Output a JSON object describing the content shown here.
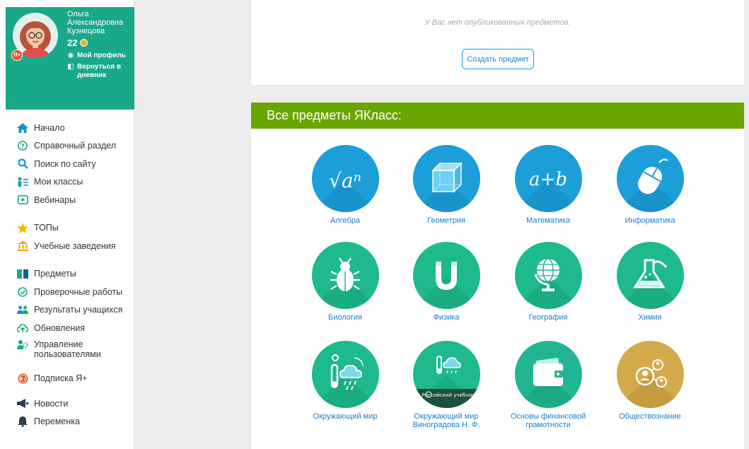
{
  "profile": {
    "name": "Ольга Александровна Кузнецова",
    "badge": "Я+",
    "points": "22",
    "my_profile": "Мой профиль",
    "back_to_diary": "Вернуться в дневник"
  },
  "nav": {
    "home": "Начало",
    "help": "Справочный раздел",
    "search": "Поиск по сайту",
    "classes": "Мои классы",
    "webinars": "Вебинары",
    "tops": "ТОПы",
    "schools": "Учебные заведения",
    "subjects": "Предметы",
    "tests": "Проверочные работы",
    "results": "Результаты учащихся",
    "updates": "Обновления",
    "users": "Управление пользователями",
    "subscription": "Подписка Я+",
    "news": "Новости",
    "break": "Переменка"
  },
  "published": {
    "empty_text": "У Вас нет опубликованных предметов.",
    "create_button": "Создать предмет"
  },
  "all_subjects": {
    "title": "Все предметы ЯКласс:",
    "algebra_icon_text": "√aⁿ",
    "math_icon_text": "a+b",
    "publisher_text": "Российский учебник",
    "items": [
      {
        "label": "Алгебра"
      },
      {
        "label": "Геометрия"
      },
      {
        "label": "Математика"
      },
      {
        "label": "Информатика"
      },
      {
        "label": "Биология"
      },
      {
        "label": "Физика"
      },
      {
        "label": "География"
      },
      {
        "label": "Химия"
      },
      {
        "label": "Окружающий мир"
      },
      {
        "label": "Окружающий мир Виноградова Н. Ф."
      },
      {
        "label": "Основы финансовой грамотности"
      },
      {
        "label": "Обществознание"
      }
    ]
  },
  "colors": {
    "profile_bg": "#18a88a",
    "header_green": "#6aa600",
    "icon_blue": "#1c9ed8",
    "icon_green": "#1eb98d",
    "icon_gold": "#d4a94a",
    "link_blue": "#1a7fc9"
  }
}
